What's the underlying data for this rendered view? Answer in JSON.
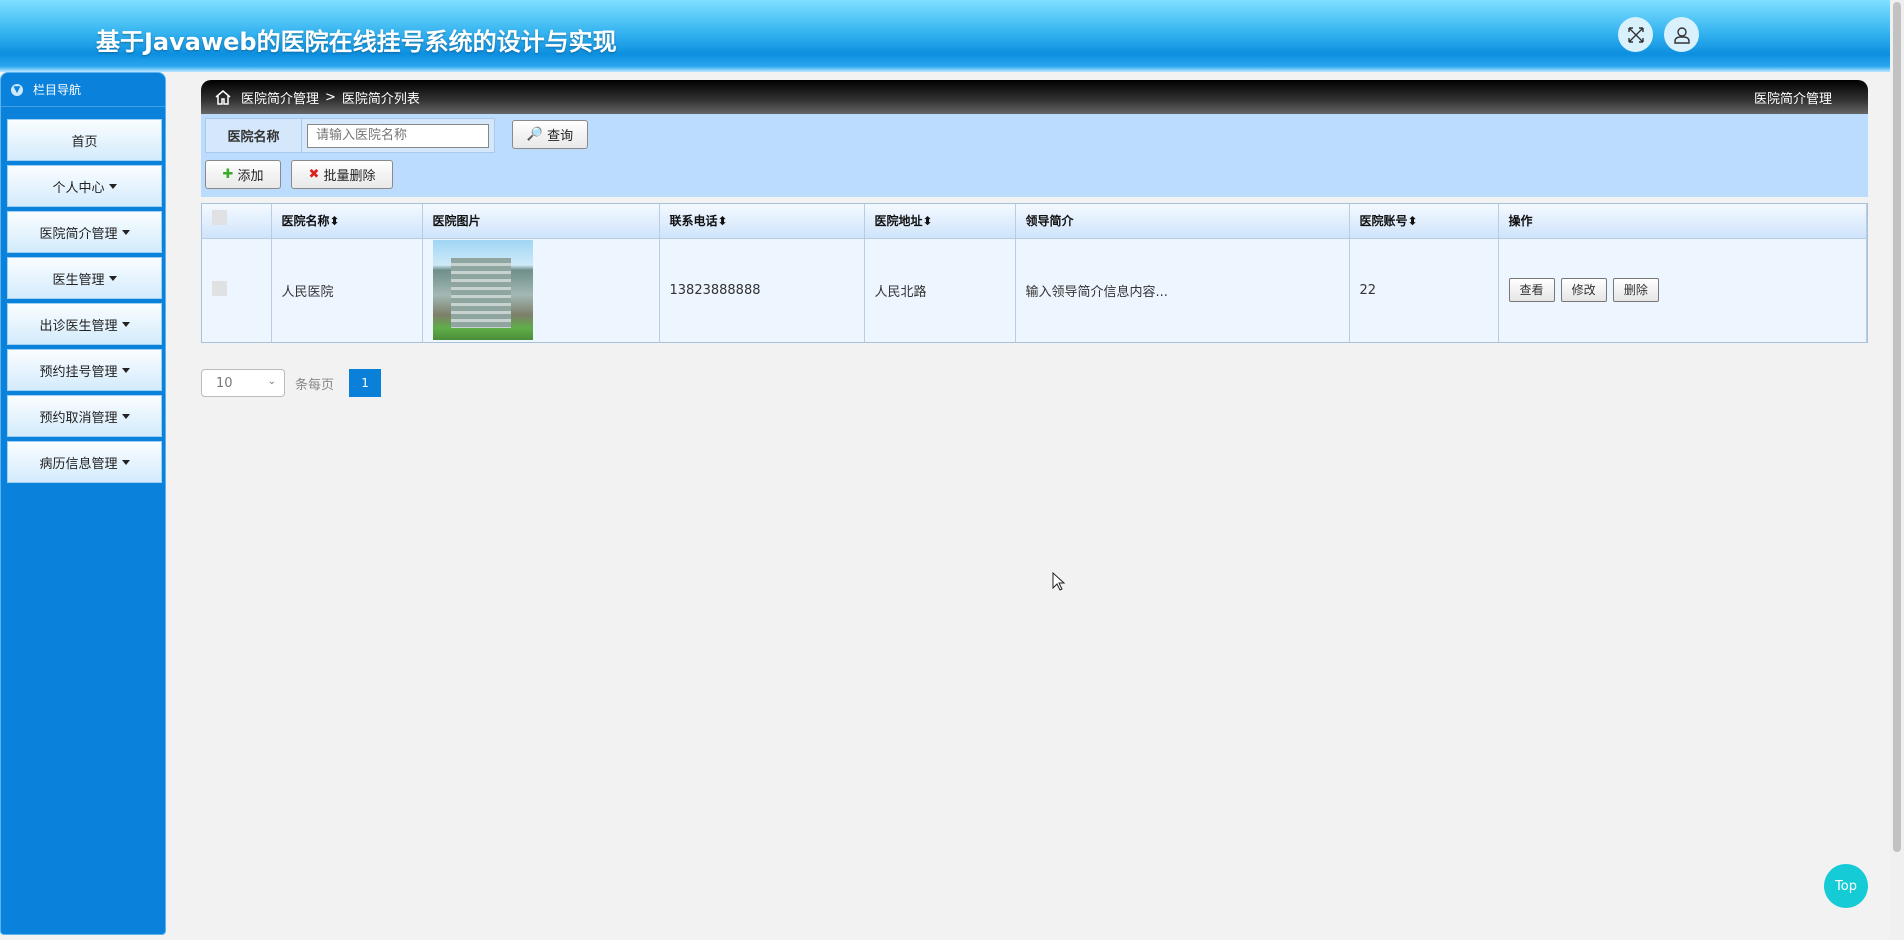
{
  "header": {
    "title": "基于Javaweb的医院在线挂号系统的设计与实现"
  },
  "sidebar": {
    "heading": "栏目导航",
    "items": [
      {
        "label": "首页",
        "dropdown": false
      },
      {
        "label": "个人中心",
        "dropdown": true
      },
      {
        "label": "医院简介管理",
        "dropdown": true
      },
      {
        "label": "医生管理",
        "dropdown": true
      },
      {
        "label": "出诊医生管理",
        "dropdown": true
      },
      {
        "label": "预约挂号管理",
        "dropdown": true
      },
      {
        "label": "预约取消管理",
        "dropdown": true
      },
      {
        "label": "病历信息管理",
        "dropdown": true
      }
    ]
  },
  "breadcrumb": {
    "parent": "医院简介管理",
    "sep": ">",
    "current": "医院简介列表",
    "right_title": "医院简介管理"
  },
  "search": {
    "label": "医院名称",
    "placeholder": "请输入医院名称",
    "value": "",
    "button": "查询"
  },
  "actions": {
    "add": "添加",
    "batch_delete": "批量删除"
  },
  "table": {
    "headers": [
      "医院名称",
      "医院图片",
      "联系电话",
      "医院地址",
      "领导简介",
      "医院账号",
      "操作"
    ],
    "sortable": [
      true,
      false,
      true,
      true,
      false,
      true,
      false
    ],
    "rows": [
      {
        "name": "人民医院",
        "phone": "13823888888",
        "address": "人民北路",
        "intro": "输入领导简介信息内容...",
        "account": "22",
        "ops": [
          "查看",
          "修改",
          "删除"
        ]
      }
    ]
  },
  "pagination": {
    "page_size": "10",
    "per_page_label": "条每页",
    "current_page": "1"
  },
  "back_to_top": "Top",
  "colors": {
    "accent": "#0a82dc",
    "top_button": "#14cbd6"
  }
}
